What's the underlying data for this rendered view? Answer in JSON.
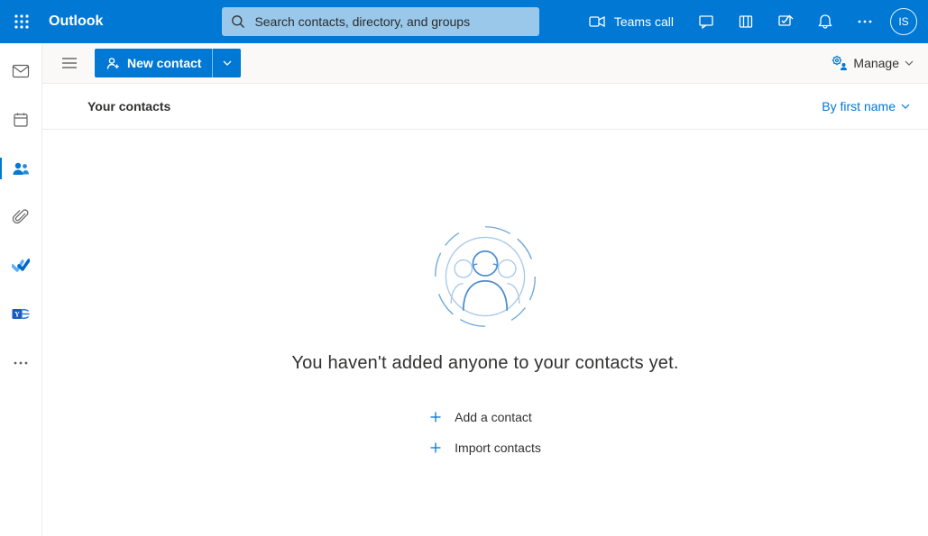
{
  "header": {
    "app_name": "Outlook",
    "search_placeholder": "Search contacts, directory, and groups",
    "teams_call_label": "Teams call",
    "avatar_initials": "IS"
  },
  "cmdbar": {
    "new_contact_label": "New contact",
    "manage_label": "Manage"
  },
  "section": {
    "title": "Your contacts",
    "sort_label": "By first name"
  },
  "empty": {
    "headline": "You haven't added anyone to your contacts yet.",
    "add_label": "Add a contact",
    "import_label": "Import contacts"
  }
}
